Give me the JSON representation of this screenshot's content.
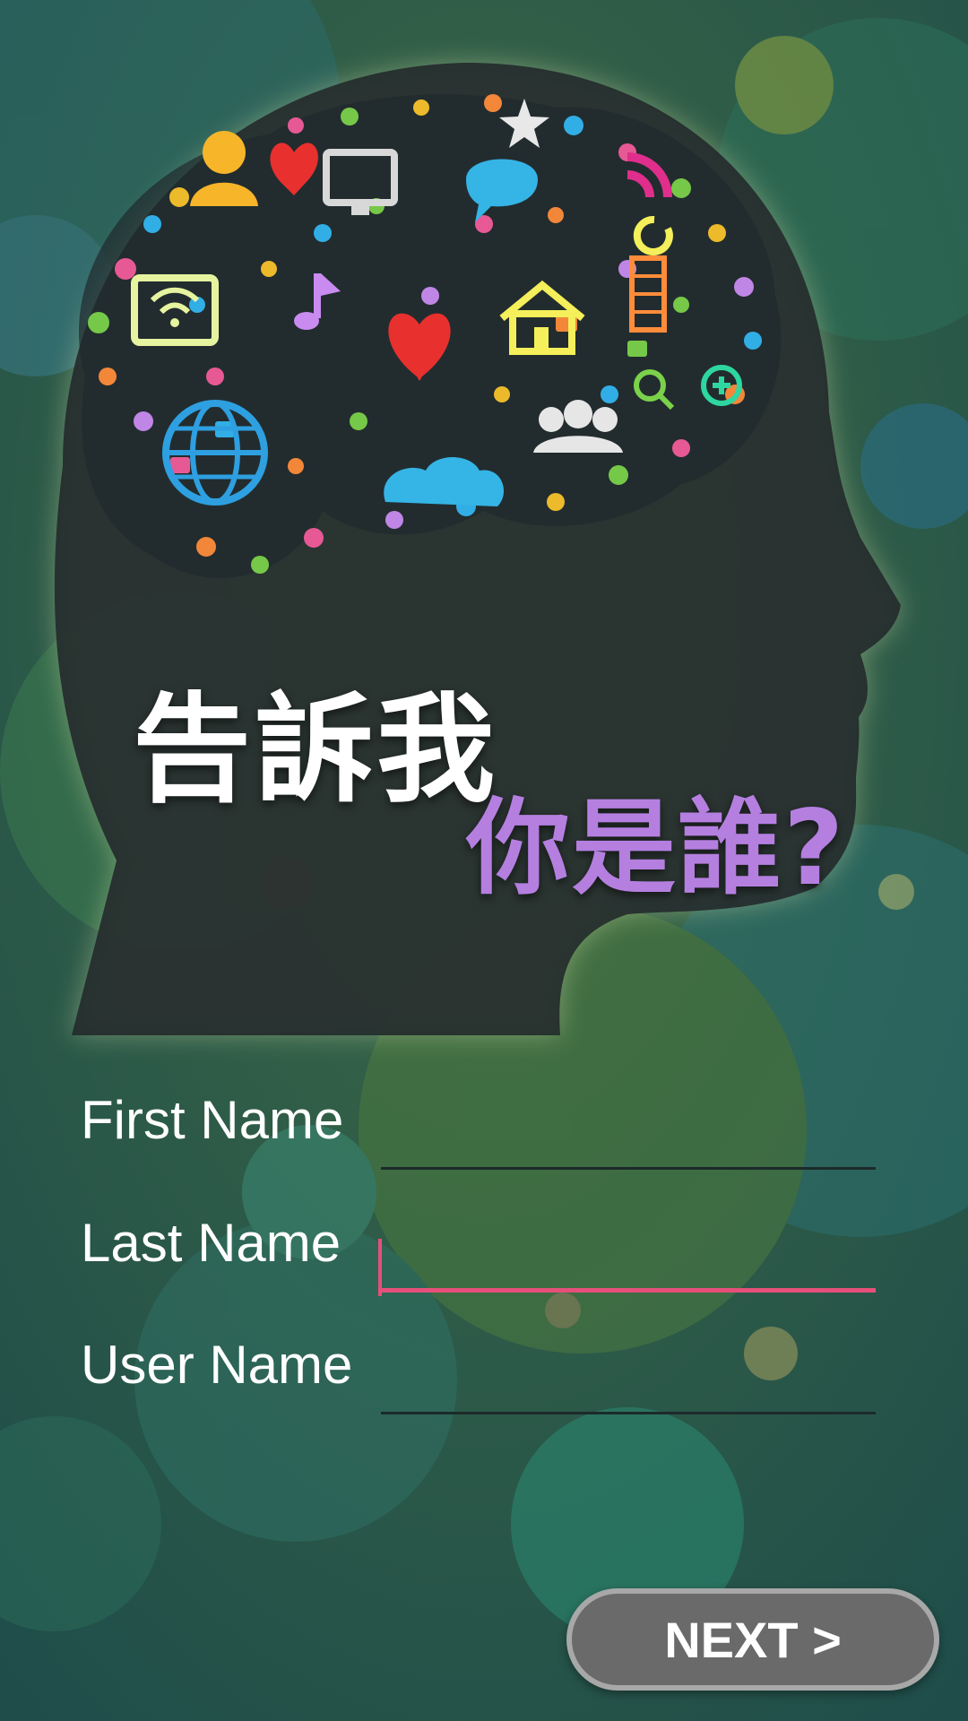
{
  "headline": {
    "line1": "告訴我",
    "line2": "你是誰?"
  },
  "form": {
    "fields": [
      {
        "label": "First Name",
        "value": ""
      },
      {
        "label": "Last Name",
        "value": ""
      },
      {
        "label": "User Name",
        "value": ""
      }
    ]
  },
  "next_button": {
    "label": "NEXT >"
  },
  "colors": {
    "headline1": "#ffffff",
    "headline2": "#b57fe0",
    "focus_underline": "#e5507a",
    "button_bg": "#6a6a6a"
  },
  "icons": [
    "user-icon",
    "heart-icon",
    "globe-icon",
    "wifi-icon",
    "home-icon",
    "cloud-icon",
    "chat-bubble-icon",
    "monitor-icon",
    "music-note-icon",
    "rss-icon",
    "star-icon",
    "film-icon",
    "group-icon",
    "search-icon",
    "refresh-icon",
    "plus-icon"
  ]
}
